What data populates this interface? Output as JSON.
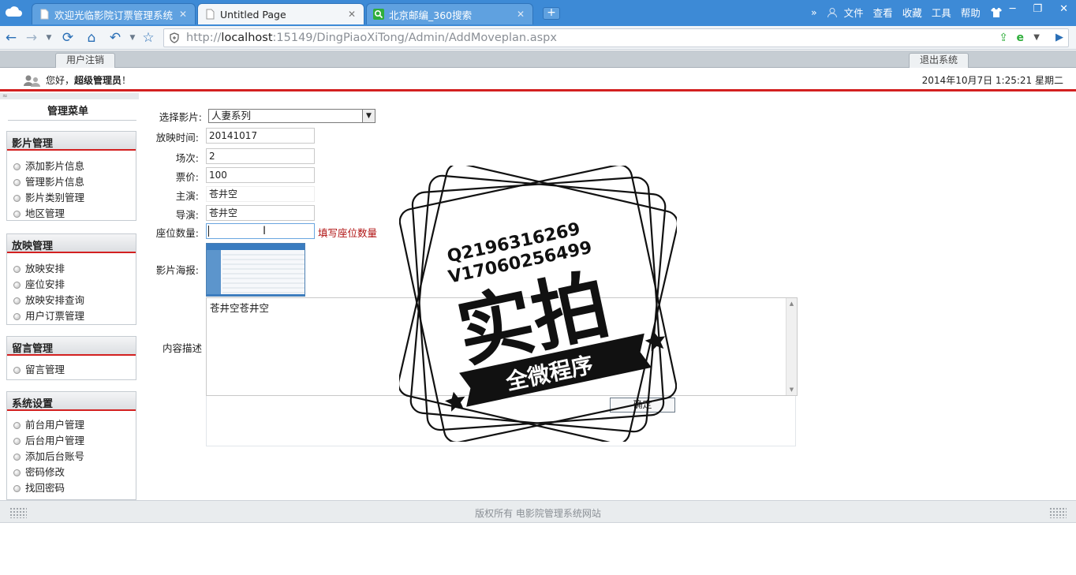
{
  "browser": {
    "tabs": [
      {
        "label": "欢迎光临影院订票管理系统",
        "active": false
      },
      {
        "label": "Untitled Page",
        "active": true
      },
      {
        "label": "北京邮编_360搜索",
        "active": false
      }
    ],
    "menu": [
      "文件",
      "查看",
      "收藏",
      "工具",
      "帮助"
    ],
    "url_host": "localhost",
    "url_prefix": "http://",
    "url_rest": ":15149/DingPiaoXiTong/Admin/AddMoveplan.aspx"
  },
  "header": {
    "logout_tab": "用户注销",
    "exit_tab": "退出系统",
    "greeting": "您好，",
    "role": "超级管理员",
    "greeting_end": "！",
    "datetime": "2014年10月7日 1:25:21 星期二"
  },
  "sidebar": {
    "title": "管理菜单",
    "groups": [
      {
        "title": "影片管理",
        "items": [
          "添加影片信息",
          "管理影片信息",
          "影片类别管理",
          "地区管理"
        ]
      },
      {
        "title": "放映管理",
        "items": [
          "放映安排",
          "座位安排",
          "放映安排查询",
          "用户订票管理"
        ]
      },
      {
        "title": "留言管理",
        "items": [
          "留言管理"
        ]
      },
      {
        "title": "系统设置",
        "items": [
          "前台用户管理",
          "后台用户管理",
          "添加后台账号",
          "密码修改",
          "找回密码"
        ]
      }
    ]
  },
  "form": {
    "movie_label": "选择影片:",
    "movie_value": "人妻系列",
    "time_label": "放映时间:",
    "time_value": "20141017",
    "session_label": "场次:",
    "session_value": "2",
    "price_label": "票价:",
    "price_value": "100",
    "actor_label": "主演:",
    "actor_value": "苍井空",
    "director_label": "导演:",
    "director_value": "苍井空",
    "seats_label": "座位数量:",
    "seats_value": "",
    "seats_hint": "填写座位数量",
    "poster_label": "影片海报:",
    "desc_label": "内容描述",
    "desc_value": "苍井空苍井空",
    "submit_label": "确定"
  },
  "watermark": {
    "line1": "Q2196316269",
    "line2": "V17060256499",
    "big": "实拍",
    "banner": "全微程序"
  },
  "footer": {
    "copyright": "版权所有 电影院管理系统网站"
  },
  "colors": {
    "chrome_blue": "#3d8ad6",
    "accent_red": "#d32020",
    "hint_red": "#b01010"
  }
}
